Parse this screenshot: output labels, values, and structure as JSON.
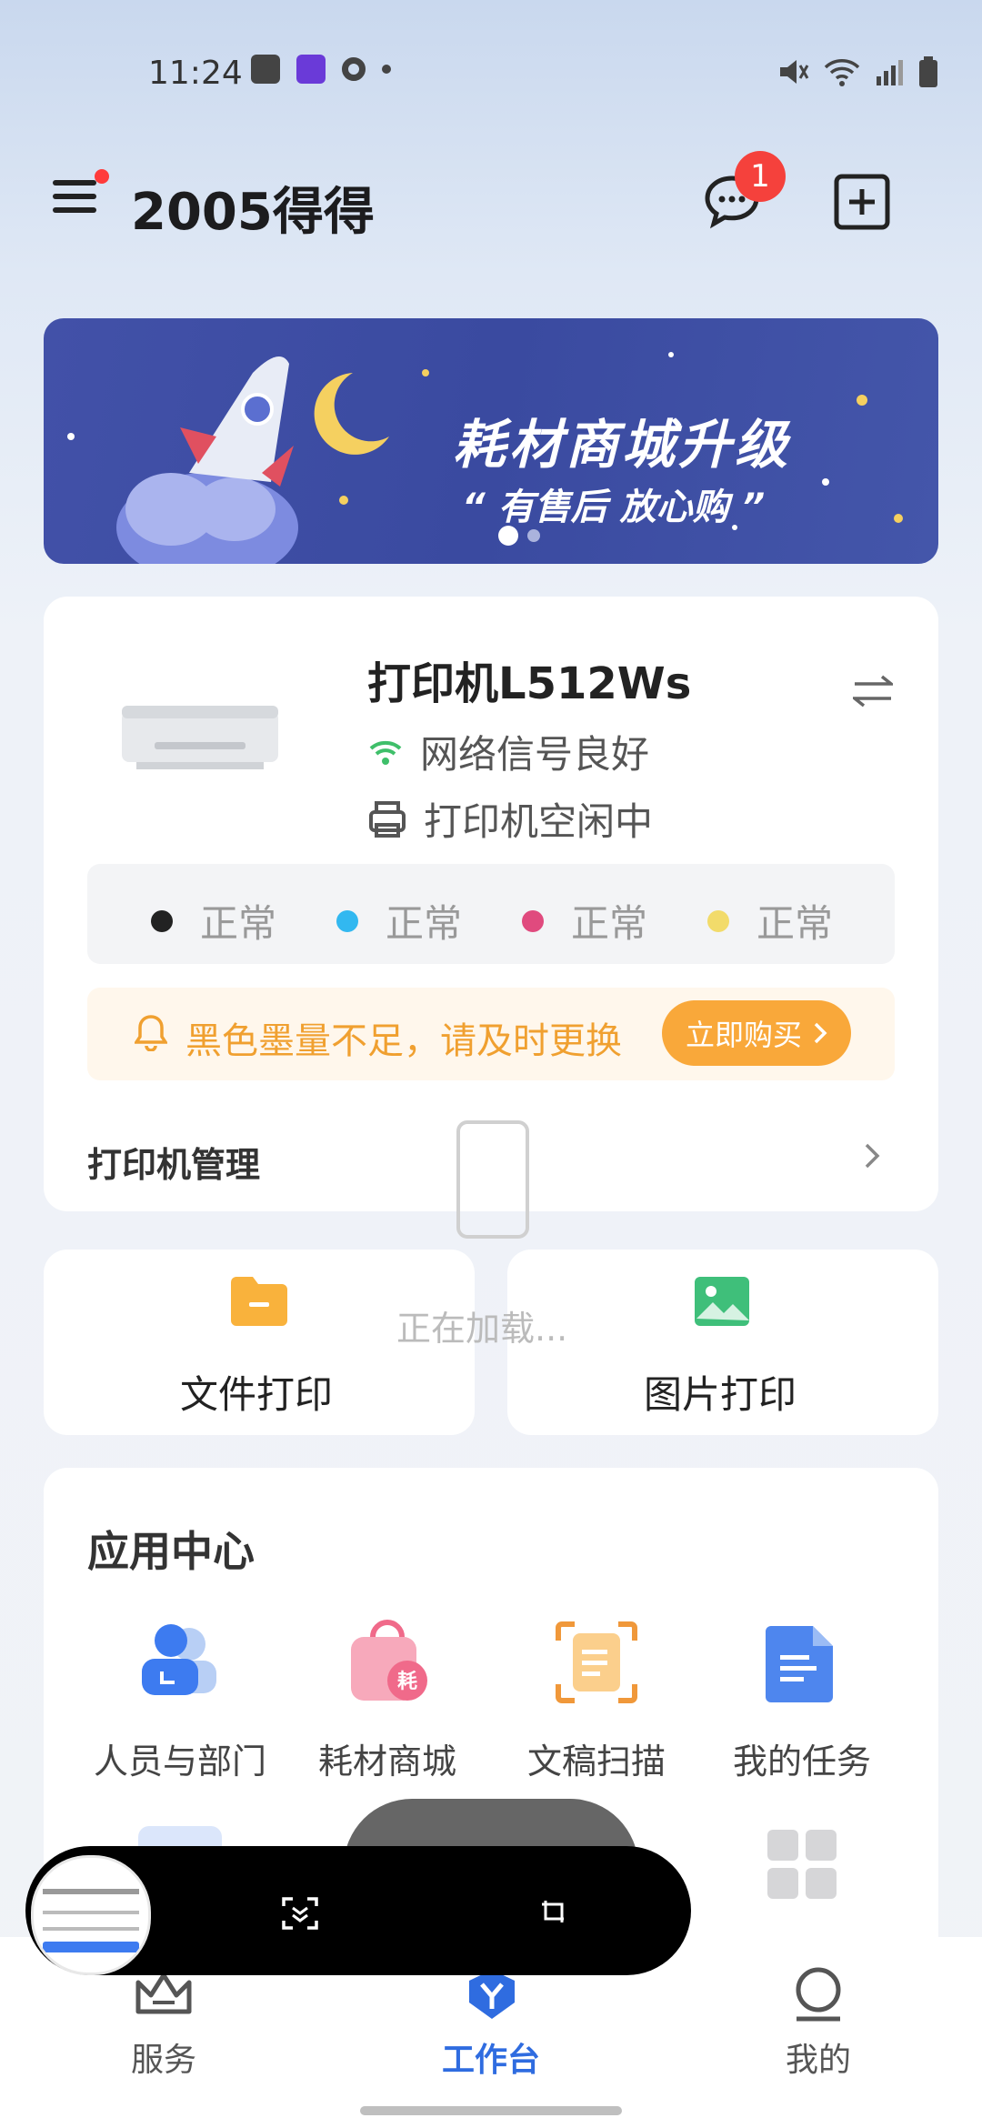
{
  "status": {
    "time": "11:24"
  },
  "header": {
    "title": "2005得得",
    "notification_count": "1"
  },
  "banner": {
    "title": "耗材商城升级",
    "subtitle": "“ 有售后 放心购 ”"
  },
  "printer": {
    "name": "打印机L512Ws",
    "network": "网络信号良好",
    "state": "打印机空闲中",
    "inks": [
      {
        "color": "#222222",
        "label": "正常"
      },
      {
        "color": "#32b8f0",
        "label": "正常"
      },
      {
        "color": "#e04a7e",
        "label": "正常"
      },
      {
        "color": "#f2db6a",
        "label": "正常"
      }
    ],
    "warning": "黑色墨量不足，请及时更换",
    "buy_label": "立即购买",
    "manage_label": "打印机管理"
  },
  "actions": {
    "file_print": "文件打印",
    "image_print": "图片打印",
    "loading": "正在加载..."
  },
  "app_center": {
    "title": "应用中心",
    "items": [
      {
        "label": "人员与部门",
        "icon": "people-icon"
      },
      {
        "label": "耗材商城",
        "icon": "shop-bag-icon"
      },
      {
        "label": "文稿扫描",
        "icon": "scan-icon"
      },
      {
        "label": "我的任务",
        "icon": "task-icon"
      }
    ]
  },
  "nav": {
    "service": "服务",
    "workbench": "工作台",
    "mine": "我的"
  },
  "colors": {
    "accent": "#2f6ce0",
    "warning": "#f9a83a",
    "badge": "#f5413c"
  }
}
